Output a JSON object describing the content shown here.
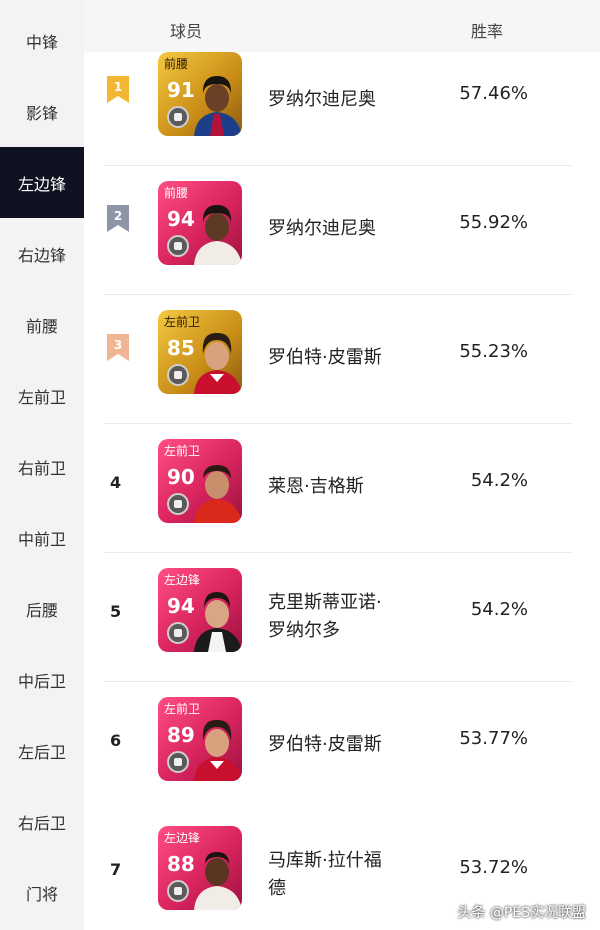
{
  "sidebar": {
    "items": [
      {
        "label": "中锋"
      },
      {
        "label": "影锋"
      },
      {
        "label": "左边锋",
        "active": true
      },
      {
        "label": "右边锋"
      },
      {
        "label": "前腰"
      },
      {
        "label": "左前卫"
      },
      {
        "label": "右前卫"
      },
      {
        "label": "中前卫"
      },
      {
        "label": "后腰"
      },
      {
        "label": "中后卫"
      },
      {
        "label": "左后卫"
      },
      {
        "label": "右后卫"
      },
      {
        "label": "门将"
      }
    ]
  },
  "header": {
    "player_label": "球员",
    "rate_label": "胜率"
  },
  "rows": [
    {
      "rank": "1",
      "badge_color": "#f2b632",
      "position": "前腰",
      "rating": "91",
      "card": "gold",
      "name": "罗纳尔迪尼奥",
      "win_rate": "57.46%"
    },
    {
      "rank": "2",
      "badge_color": "#8e95a6",
      "position": "前腰",
      "rating": "94",
      "card": "pink",
      "name": "罗纳尔迪尼奥",
      "win_rate": "55.92%"
    },
    {
      "rank": "3",
      "badge_color": "#f0b593",
      "position": "左前卫",
      "rating": "85",
      "card": "gold",
      "name": "罗伯特·皮雷斯",
      "win_rate": "55.23%"
    },
    {
      "rank": "4",
      "position": "左前卫",
      "rating": "90",
      "card": "pink",
      "name": "莱恩·吉格斯",
      "win_rate": "54.2%"
    },
    {
      "rank": "5",
      "position": "左边锋",
      "rating": "94",
      "card": "pink",
      "name_line1": "克里斯蒂亚诺·",
      "name_line2": "罗纳尔多",
      "win_rate": "54.2%"
    },
    {
      "rank": "6",
      "position": "左前卫",
      "rating": "89",
      "card": "pink",
      "name": "罗伯特·皮雷斯",
      "win_rate": "53.77%"
    },
    {
      "rank": "7",
      "position": "左边锋",
      "rating": "88",
      "card": "pink",
      "name_line1": "马库斯·拉什福",
      "name_line2": "德",
      "win_rate": "53.72%"
    }
  ],
  "watermark": "头条 @PES实况联盟"
}
